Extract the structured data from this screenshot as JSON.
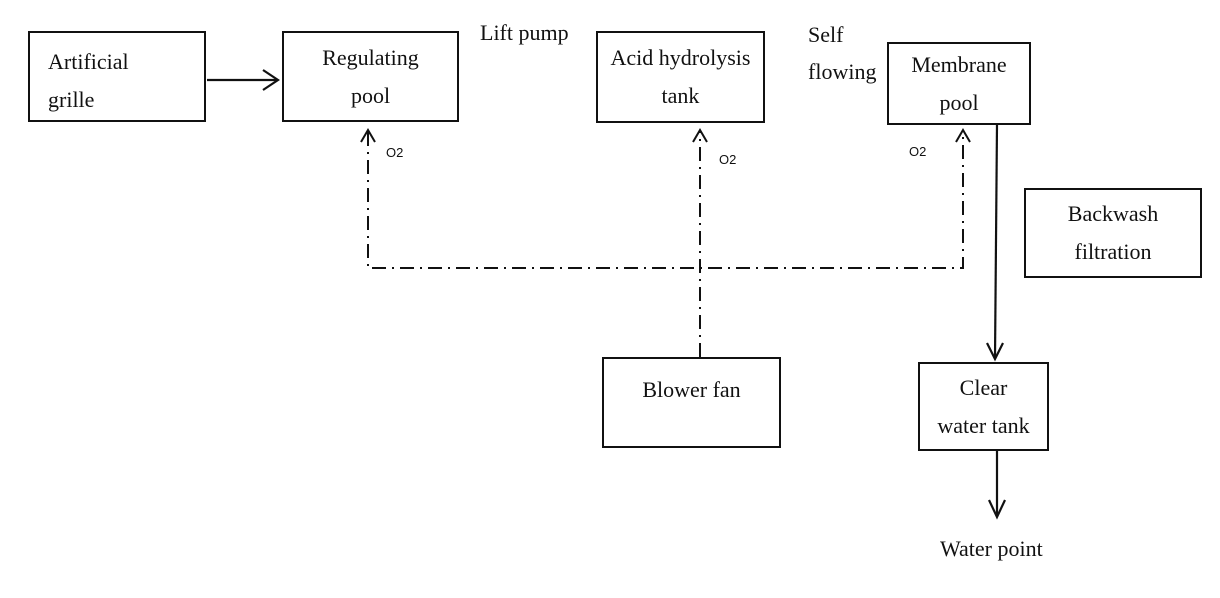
{
  "nodes": {
    "artificial_grille": [
      "Artificial",
      "grille"
    ],
    "regulating_pool": [
      "Regulating",
      "pool"
    ],
    "acid_hydrolysis_tank": [
      "Acid hydrolysis",
      "tank"
    ],
    "membrane_pool": [
      "Membrane",
      "pool"
    ],
    "backwash_filtration": [
      "Backwash",
      "filtration"
    ],
    "blower_fan": "Blower fan",
    "clear_water_tank": [
      "Clear",
      "water tank"
    ]
  },
  "edge_labels": {
    "lift_pump": "Lift pump",
    "self_flowing": [
      "Self",
      "flowing"
    ],
    "water_point": "Water point",
    "o2": "O2"
  }
}
